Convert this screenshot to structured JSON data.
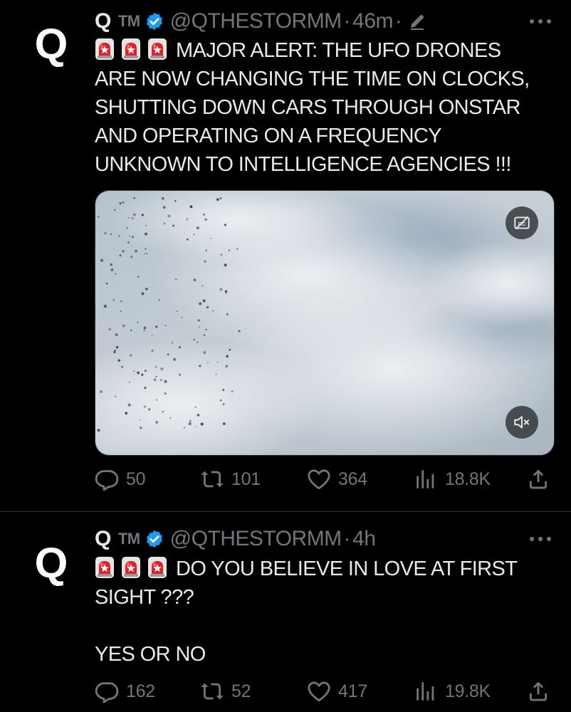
{
  "tweets": [
    {
      "avatar_letter": "Q",
      "display_name": "Q",
      "badge_tm": "TM",
      "handle": "@QTHESTORMM",
      "time": "46m",
      "text_line1": "MAJOR ALERT: THE UFO DRONES",
      "text_rest": "ARE NOW CHANGING THE TIME ON CLOCKS,\nSHUTTING DOWN CARS THROUGH ONSTAR\nAND OPERATING ON A FREQUENCY\nUNKNOWN TO INTELLIGENCE AGENCIES !!!",
      "emoji_icon": "police-car-light-emoji",
      "emoji_count": 3,
      "has_video": true,
      "edited": true,
      "stats": {
        "replies": "50",
        "reposts": "101",
        "likes": "364",
        "views": "18.8K"
      }
    },
    {
      "avatar_letter": "Q",
      "display_name": "Q",
      "badge_tm": "TM",
      "handle": "@QTHESTORMM",
      "time": "4h",
      "text_line1": "DO YOU BELIEVE IN LOVE AT FIRST",
      "text_rest": "SIGHT ???\n\nYES OR NO",
      "emoji_icon": "police-car-light-emoji",
      "emoji_count": 3,
      "has_video": false,
      "edited": false,
      "stats": {
        "replies": "162",
        "reposts": "52",
        "likes": "417",
        "views": "19.8K"
      }
    }
  ],
  "colors": {
    "background": "#000000",
    "text": "#e7e9ea",
    "muted": "#71767b",
    "verified_blue": "#1d9bf0",
    "divider": "#2f3336",
    "siren_red": "#e0202a"
  },
  "icons": {
    "verified": "verified-badge-icon",
    "edit": "pencil-edit-icon",
    "more": "more-dots-icon",
    "captions": "captions-icon",
    "mute": "muted-speaker-icon",
    "reply": "reply-icon",
    "repost": "repost-icon",
    "like": "heart-icon",
    "views": "views-bar-icon",
    "share": "share-icon"
  }
}
